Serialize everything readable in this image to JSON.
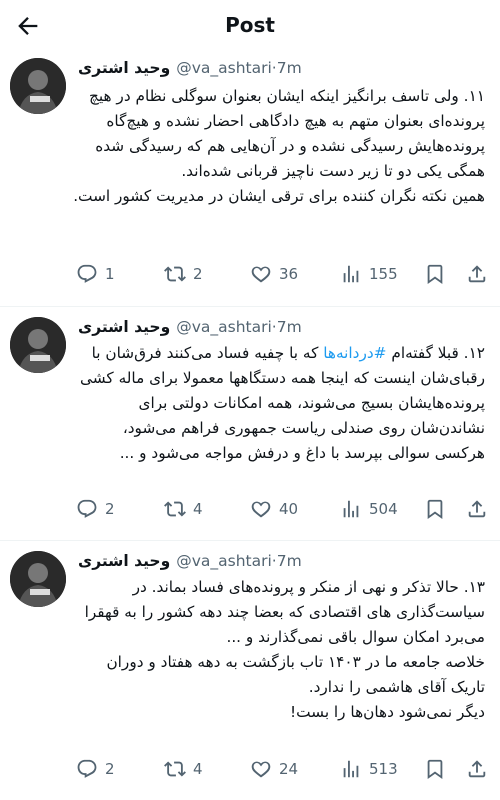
{
  "header": {
    "title": "Post"
  },
  "tweets": [
    {
      "name": "وحید اشتری",
      "handle": "@va_ashtari",
      "separator": "·",
      "time": "7m",
      "text": "۱۱. ولی تاسف برانگیز اینکه ایشان بعنوان سوگلی نظام در هیچ پرونده‌ای بعنوان متهم به هیچ دادگاهی احضار نشده و هیچ‌گاه پرونده‌هایش رسیدگی نشده و در آن‌هایی هم که رسیدگی شده همگی یکی دو تا زیر دست ناچیز قربانی شده‌اند.\nهمین نکته نگران کننده برای ترقی ایشان در مدیریت کشور است.",
      "replies": "1",
      "reposts": "2",
      "likes": "36",
      "views": "155"
    },
    {
      "name": "وحید اشتری",
      "handle": "@va_ashtari",
      "separator": "·",
      "time": "7m",
      "text_before": "۱۲. قبلا گفته‌ام ",
      "hashtag": "#دردانه‌ها",
      "text_after": " که با چفیه فساد می‌کنند فرق‌شان با رقبای‌شان اینست که اینجا همه دستگاهها معمولا برای ماله کشی پرونده‌هایشان بسیج می‌شوند، همه امکانات دولتی برای نشاندن‌شان روی صندلی ریاست جمهوری فراهم می‌شود، هرکسی سوالی بپرسد با داغ و درفش مواجه می‌شود و ...",
      "replies": "2",
      "reposts": "4",
      "likes": "40",
      "views": "504"
    },
    {
      "name": "وحید اشتری",
      "handle": "@va_ashtari",
      "separator": "·",
      "time": "7m",
      "text": "۱۳. حالا تذکر و نهی از منکر و پرونده‌های فساد بماند. در سیاست‌گذاری های اقتصادی که بعضا چند دهه کشور را به قهقرا می‌برد امکان سوال باقی نمی‌گذارند و ...\nخلاصه جامعه ما در ۱۴۰۳ تاب بازگشت به دهه هفتاد و دوران تاریک آقای هاشمی را ندارد.\nدیگر نمی‌شود دهان‌ها را بست!",
      "replies": "2",
      "reposts": "4",
      "likes": "24",
      "views": "513"
    }
  ]
}
